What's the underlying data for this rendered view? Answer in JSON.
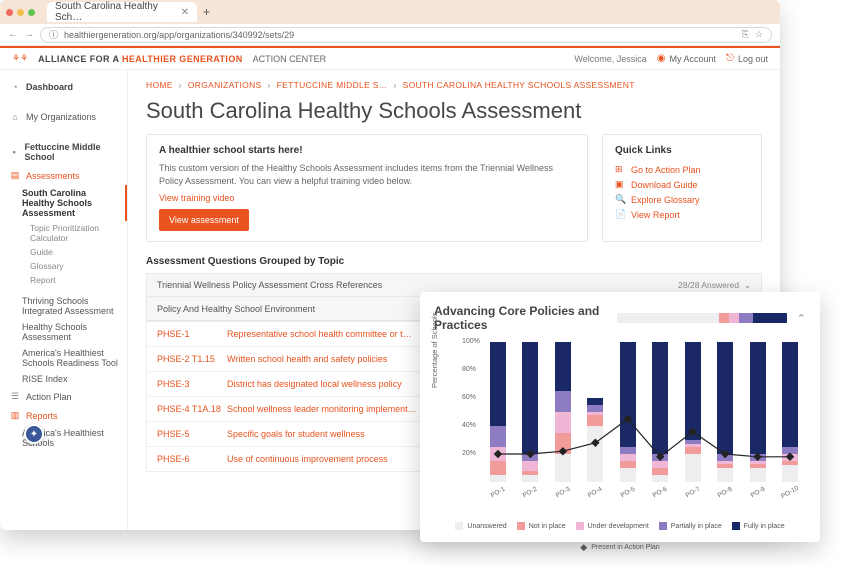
{
  "browser": {
    "tab_title": "South Carolina Healthy Sch…",
    "url": "healthiergeneration.org/app/organizations/340992/sets/29"
  },
  "header": {
    "brand_pre": "ALLIANCE FOR A ",
    "brand_em": "HEALTHIER GENERATION",
    "action_center": "ACTION CENTER",
    "welcome": "Welcome, Jessica",
    "my_account": "My Account",
    "log_out": "Log out"
  },
  "sidebar": {
    "dashboard": "Dashboard",
    "my_org": "My Organizations",
    "school": "Fettuccine Middle School",
    "assessments": "Assessments",
    "current": "South Carolina Healthy Schools Assessment",
    "subs": {
      "tpc": "Topic Prioritization Calculator",
      "guide": "Guide",
      "glossary": "Glossary",
      "report": "Report"
    },
    "others": {
      "tsia": "Thriving Schools Integrated Assessment",
      "hsa": "Healthy Schools Assessment",
      "ahsr": "America's Healthiest Schools Readiness Tool",
      "rise": "RISE Index"
    },
    "action_plan": "Action Plan",
    "reports": "Reports",
    "ah_schools": "America's Healthiest Schools"
  },
  "crumbs": {
    "home": "HOME",
    "orgs": "ORGANIZATIONS",
    "school": "FETTUCCINE MIDDLE S…",
    "cur": "SOUTH CAROLINA HEALTHY SCHOOLS ASSESSMENT"
  },
  "page_title": "South Carolina Healthy Schools Assessment",
  "intro_card": {
    "title": "A healthier school starts here!",
    "body": "This custom version of the Healthy Schools Assessment includes items from the Triennial Wellness Policy Assessment. You can view a helpful training video below.",
    "link": "View training video",
    "button": "View assessment"
  },
  "quick_links": {
    "title": "Quick Links",
    "items": [
      {
        "icon": "⊞",
        "label": "Go to Action Plan"
      },
      {
        "icon": "▣",
        "label": "Download Guide"
      },
      {
        "icon": "🔍",
        "label": "Explore Glossary"
      },
      {
        "icon": "📄",
        "label": "View Report"
      }
    ]
  },
  "topics": {
    "heading": "Assessment Questions Grouped by Topic",
    "acc1_title": "Triennial Wellness Policy Assessment Cross References",
    "acc1_ans": "28/28 Answered",
    "acc2_title": "Policy And Healthy School Environment",
    "rows": [
      {
        "id": "PHSE-1",
        "desc": "Representative school health committee or t…"
      },
      {
        "id": "PHSE-2 T1.15",
        "desc": "Written school health and safety policies"
      },
      {
        "id": "PHSE-3",
        "desc": "District has designated local wellness policy"
      },
      {
        "id": "PHSE-4 T1A.18",
        "desc": "School wellness leader monitoring implement…"
      },
      {
        "id": "PHSE-5",
        "desc": "Specific goals for student wellness"
      },
      {
        "id": "PHSE-6",
        "desc": "Use of continuous improvement process"
      }
    ]
  },
  "chart_data": {
    "type": "bar",
    "title": "Advancing Core Policies and Practices",
    "ylabel": "Percentage of Schools",
    "categories": [
      "PO-1",
      "PO-2",
      "PO-3",
      "PO-4",
      "PO-5",
      "PO-6",
      "PO-7",
      "PO-8",
      "PO-9",
      "PO-10"
    ],
    "ylim": [
      0,
      100
    ],
    "ticks": [
      100,
      80,
      60,
      40,
      20
    ],
    "legend": [
      "Unanswered",
      "Not in place",
      "Under development",
      "Partially in place",
      "Fully in place"
    ],
    "legend_line": "Present in Action Plan",
    "header_stack": {
      "unanswered": 60,
      "not_in_place": 6,
      "under_dev": 6,
      "partial": 8,
      "full": 20
    },
    "series": [
      {
        "unanswered": 5,
        "not_in_place": 10,
        "under_dev": 10,
        "partial": 15,
        "full": 60
      },
      {
        "unanswered": 5,
        "not_in_place": 3,
        "under_dev": 7,
        "partial": 5,
        "full": 80
      },
      {
        "unanswered": 20,
        "not_in_place": 15,
        "under_dev": 15,
        "partial": 15,
        "full": 35
      },
      {
        "unanswered": 40,
        "not_in_place": 8,
        "under_dev": 2,
        "partial": 5,
        "full": 5
      },
      {
        "unanswered": 10,
        "not_in_place": 5,
        "under_dev": 5,
        "partial": 5,
        "full": 75
      },
      {
        "unanswered": 5,
        "not_in_place": 5,
        "under_dev": 5,
        "partial": 5,
        "full": 80
      },
      {
        "unanswered": 20,
        "not_in_place": 5,
        "under_dev": 2,
        "partial": 3,
        "full": 70
      },
      {
        "unanswered": 10,
        "not_in_place": 3,
        "under_dev": 2,
        "partial": 5,
        "full": 80
      },
      {
        "unanswered": 10,
        "not_in_place": 3,
        "under_dev": 2,
        "partial": 5,
        "full": 80
      },
      {
        "unanswered": 12,
        "not_in_place": 3,
        "under_dev": 5,
        "partial": 5,
        "full": 75
      }
    ],
    "line_values": [
      20,
      20,
      22,
      28,
      45,
      18,
      36,
      20,
      18,
      18
    ]
  }
}
